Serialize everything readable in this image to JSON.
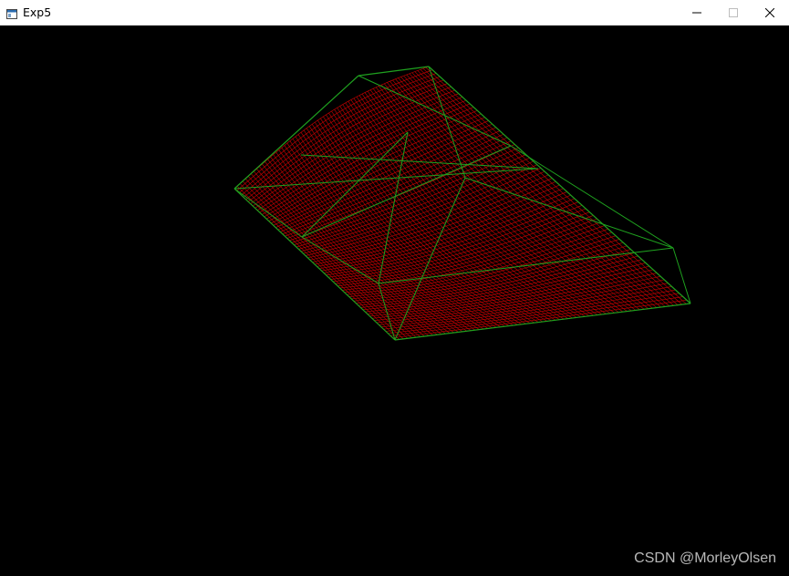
{
  "window": {
    "title": "Exp5",
    "icon": "app-window-icon"
  },
  "titlebar_buttons": {
    "minimize": "minimize-icon",
    "maximize": "maximize-icon",
    "close": "close-icon"
  },
  "canvas": {
    "background_color": "#000000",
    "surface_color": "#cc0000",
    "wireframe_color": "#1fa11f"
  },
  "watermark": {
    "text": "CSDN @MorleyOlsen"
  }
}
